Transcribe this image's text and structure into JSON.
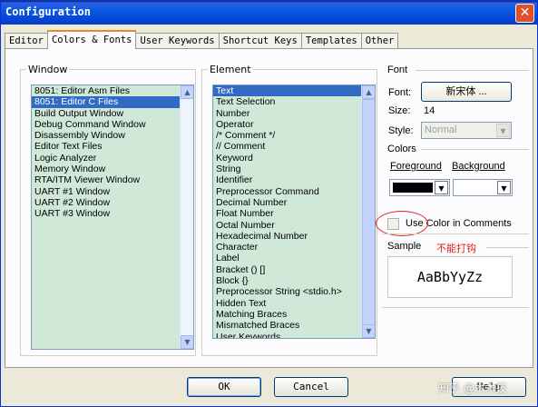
{
  "window": {
    "title": "Configuration",
    "close_glyph": "✕"
  },
  "tabs": [
    {
      "label": "Editor"
    },
    {
      "label": "Colors & Fonts"
    },
    {
      "label": "User Keywords"
    },
    {
      "label": "Shortcut Keys"
    },
    {
      "label": "Templates"
    },
    {
      "label": "Other"
    }
  ],
  "window_group": {
    "label": "Window",
    "items": [
      "8051: Editor Asm Files",
      "8051: Editor C Files",
      "Build Output Window",
      "Debug Command Window",
      "Disassembly Window",
      "Editor Text Files",
      "Logic Analyzer",
      "Memory Window",
      "RTA/ITM Viewer Window",
      "UART #1 Window",
      "UART #2 Window",
      "UART #3 Window"
    ],
    "selected_index": 1
  },
  "element_group": {
    "label": "Element",
    "items": [
      "Text",
      "Text Selection",
      "Number",
      "Operator",
      "/* Comment */",
      "// Comment",
      "Keyword",
      "String",
      "Identifier",
      "Preprocessor Command",
      "Decimal Number",
      "Float Number",
      "Octal Number",
      "Hexadecimal Number",
      "Character",
      "Label",
      "Bracket () []",
      "Block {}",
      "Preprocessor String <stdio.h>",
      "Hidden Text",
      "Matching Braces",
      "Mismatched Braces",
      "User Keywords"
    ],
    "selected_index": 0
  },
  "font": {
    "label": "Font",
    "font_label": "Font:",
    "font_button": "新宋体 ...",
    "size_label": "Size:",
    "size_value": "14",
    "style_label": "Style:",
    "style_value": "Normal"
  },
  "colors": {
    "label": "Colors",
    "foreground_label": "Foreground",
    "background_label": "Background",
    "foreground_color": "#000000",
    "background_color": "#ffffff",
    "use_color_label": "Use Color in Comments"
  },
  "sample": {
    "label": "Sample",
    "text": "AaBbYyZz",
    "annotation": "不能打钩"
  },
  "buttons": {
    "ok": "OK",
    "cancel": "Cancel",
    "help": "Help"
  },
  "watermark": "知乎 @木木技"
}
